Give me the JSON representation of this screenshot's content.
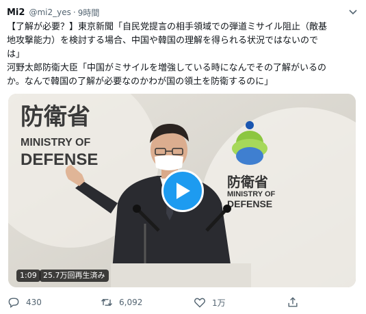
{
  "tweet": {
    "display_name": "Mi2",
    "handle": "@mi2_yes",
    "separator": "·",
    "time": "9時間",
    "text_lines": [
      "【了解が必要？】東京新聞「自民党提言の相手領域での弾道ミサイル阻止（敵基",
      "地攻撃能力）を検討する場合、中国や韓国の理解を得られる状況ではないので",
      "は」",
      "河野太郎防衛大臣「中国がミサイルを増強している時になんでその了解がいるの",
      "か。なんで韓国の了解が必要なのかわが国の領土を防衛するのに」"
    ]
  },
  "video": {
    "backdrop_kanji": "防衛省",
    "backdrop_en_1": "MINISTRY OF",
    "backdrop_en_2": "DEFENSE",
    "podium_kanji": "防衛省",
    "podium_en_1": "MINISTRY OF",
    "podium_en_2": "DEFENSE",
    "duration": "1:09",
    "views": "25.7万回再生済み"
  },
  "actions": {
    "reply_count": "430",
    "retweet_count": "6,092",
    "like_count": "1万",
    "share_count": ""
  },
  "icons": [
    "chevron-down-icon",
    "play-icon",
    "reply-icon",
    "retweet-icon",
    "like-icon",
    "share-icon"
  ],
  "colors": {
    "accent": "#1d9bf0",
    "muted": "#536471",
    "text": "#0f1419"
  }
}
